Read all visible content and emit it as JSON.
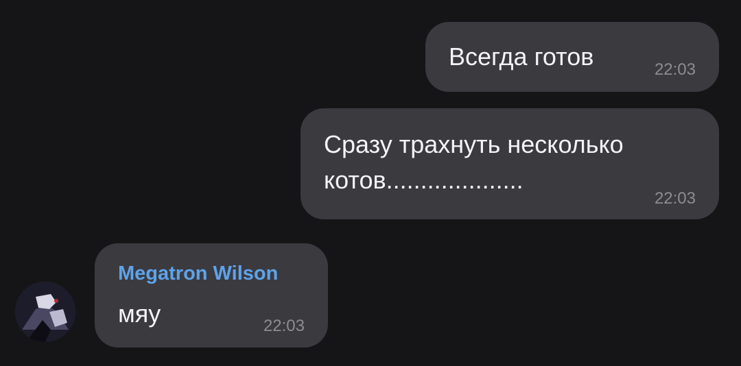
{
  "messages": [
    {
      "direction": "outgoing",
      "text": "Всегда готов",
      "time": "22:03"
    },
    {
      "direction": "outgoing",
      "text": "Сразу трахнуть несколько\nкотов....................",
      "time": "22:03"
    },
    {
      "direction": "incoming",
      "sender": "Megatron Wilson",
      "text": "мяу",
      "time": "22:03"
    }
  ],
  "colors": {
    "background": "#151417",
    "bubble": "#3b3a3f",
    "sender_name": "#5ea3ea",
    "timestamp": "#8d8c93"
  },
  "icons": [
    "avatar-image"
  ]
}
